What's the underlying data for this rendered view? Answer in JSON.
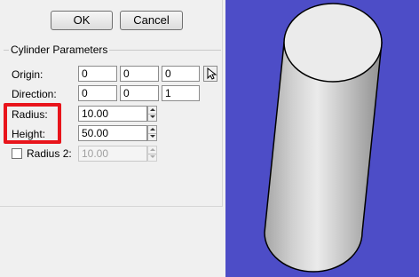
{
  "dialog": {
    "ok_label": "OK",
    "cancel_label": "Cancel",
    "group_title": "Cylinder Parameters",
    "origin": {
      "label": "Origin:",
      "x": "0",
      "y": "0",
      "z": "0"
    },
    "direction": {
      "label": "Direction:",
      "x": "0",
      "y": "0",
      "z": "1"
    },
    "radius": {
      "label": "Radius:",
      "value": "10.00"
    },
    "height": {
      "label": "Height:",
      "value": "50.00"
    },
    "radius2": {
      "label": "Radius 2:",
      "value": "10.00",
      "checked": false,
      "enabled": false
    },
    "highlight_color": "#e8141b"
  },
  "viewport": {
    "background_color": "#4d4dc7",
    "shape": "cylinder-icon"
  }
}
